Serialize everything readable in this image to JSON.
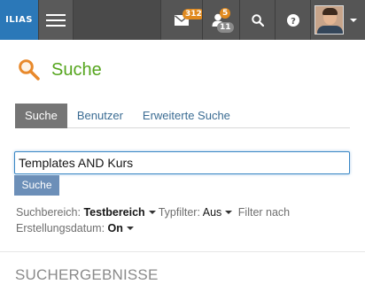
{
  "topbar": {
    "logo_text": "ILIAS",
    "mail_badge": "312",
    "contacts_badge_new": "5",
    "contacts_badge_total": "11"
  },
  "header": {
    "title": "Suche",
    "icon": "magnifier-icon"
  },
  "tabs": [
    {
      "label": "Suche",
      "active": true
    },
    {
      "label": "Benutzer",
      "active": false
    },
    {
      "label": "Erweiterte Suche",
      "active": false
    }
  ],
  "search": {
    "value": "Templates AND Kurs",
    "button_label": "Suche"
  },
  "filters": {
    "area_label": "Suchbereich:",
    "area_value": "Testbereich",
    "type_label": "Typfilter:",
    "type_value": "Aus",
    "date_label": "Filter nach Erstellungsdatum:",
    "date_value": "On"
  },
  "results": {
    "heading": "SUCHERGEBNISSE"
  },
  "colors": {
    "brand_blue": "#2b78b8",
    "title_green": "#55a51d",
    "badge_orange": "#e08a1f",
    "tab_active": "#757575",
    "link": "#3b6c93"
  }
}
